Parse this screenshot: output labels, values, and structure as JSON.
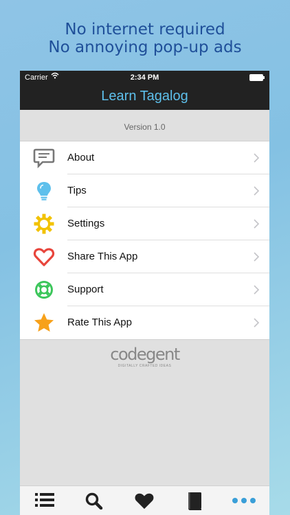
{
  "promo": {
    "line1": "No internet required",
    "line2": "No annoying pop-up ads",
    "color": "#1f4f99"
  },
  "statusbar": {
    "carrier": "Carrier",
    "time": "2:34 PM"
  },
  "navbar": {
    "title": "Learn Tagalog",
    "title_color": "#5ec0ec"
  },
  "version": "Version 1.0",
  "menu": {
    "items": [
      {
        "label": "About",
        "icon": "speech-bubble-icon",
        "color": "#777777"
      },
      {
        "label": "Tips",
        "icon": "lightbulb-icon",
        "color": "#5ec0ec"
      },
      {
        "label": "Settings",
        "icon": "gear-icon",
        "color": "#f2c200"
      },
      {
        "label": "Share This App",
        "icon": "heart-icon",
        "color": "#e8453c"
      },
      {
        "label": "Support",
        "icon": "lifebuoy-icon",
        "color": "#3cc65b"
      },
      {
        "label": "Rate This App",
        "icon": "star-icon",
        "color": "#f7a11a"
      }
    ]
  },
  "brand": {
    "name": "codegent",
    "tagline": "DIGITALLY CRAFTED IDEAS"
  },
  "tabbar": {
    "tabs": [
      {
        "icon": "list-icon"
      },
      {
        "icon": "search-icon"
      },
      {
        "icon": "heart-icon"
      },
      {
        "icon": "book-icon"
      },
      {
        "icon": "more-icon",
        "active": true,
        "active_color": "#3a9fd8"
      }
    ]
  }
}
